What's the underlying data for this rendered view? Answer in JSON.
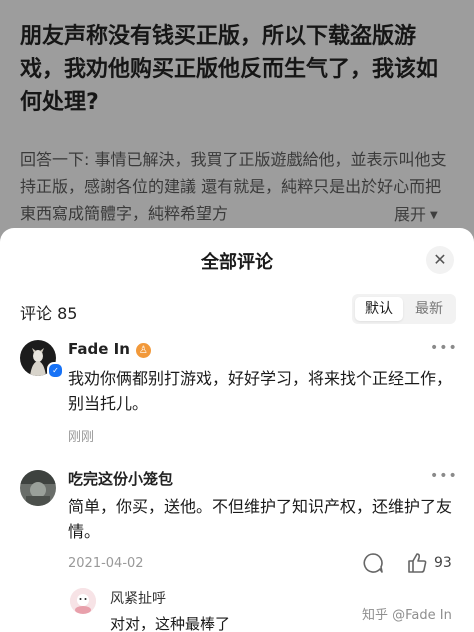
{
  "question": {
    "title": "朋友声称没有钱买正版，所以下载盗版游戏，我劝他购买正版他反而生气了，我该如何处理?",
    "description": "回答一下: 事情已解決，我買了正版遊戲給他，並表示叫他支持正版，感謝各位的建議 還有就是，純粹只是出於好心而把東西寫成簡體字，純粹希望方",
    "expand_label": "展开"
  },
  "sheet": {
    "title": "全部评论",
    "comment_count_label": "评论 85",
    "sort_options": [
      "默认",
      "最新"
    ],
    "sort_selected": "默认"
  },
  "comments": [
    {
      "author": "Fade In",
      "text": "我劝你俩都别打游戏，好好学习，将来找个正经工作，别当托儿。",
      "time": "刚刚"
    },
    {
      "author": "吃完这份小笼包",
      "text": "简单，你买，送他。不但维护了知识产权，还维护了友情。",
      "time": "2021-04-02",
      "likes": "93",
      "reply": {
        "author": "风紧扯呼",
        "text": "对对，这种最棒了"
      }
    }
  ],
  "watermark": "知乎 @Fade In",
  "colors": {
    "verify_blue": "#1772f6",
    "badge_orange": "#f2993a"
  }
}
